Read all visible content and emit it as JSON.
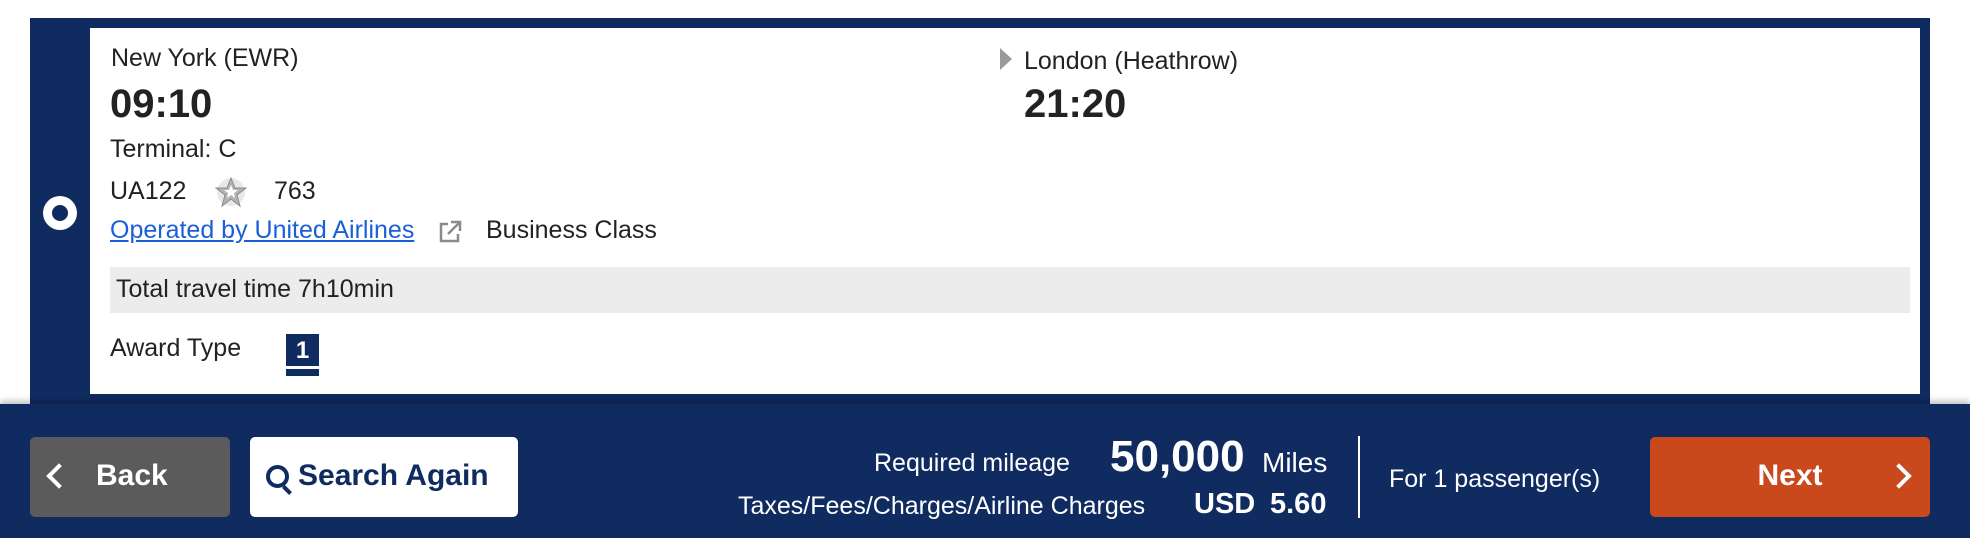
{
  "flight": {
    "origin_city": "New York (EWR)",
    "departure_time": "09:10",
    "destination_city": "London (Heathrow)",
    "arrival_time": "21:20",
    "terminal": "Terminal: C",
    "flight_number": "UA122",
    "aircraft": "763",
    "operated_by": "Operated by United Airlines",
    "cabin_class": "Business Class",
    "total_travel_time": "Total travel time 7h10min",
    "award_type_label": "Award Type",
    "award_type_value": "1"
  },
  "footer": {
    "back_label": "Back",
    "search_again_label": "Search Again",
    "required_mileage_label": "Required mileage",
    "mileage_value": "50,000",
    "mileage_unit": "Miles",
    "taxes_label": "Taxes/Fees/Charges/Airline Charges",
    "currency": "USD",
    "taxes_value": "5.60",
    "passengers": "For 1 passenger(s)",
    "next_label": "Next"
  },
  "icons": {
    "radio": "radio-button-icon",
    "arrow": "arrow-right-icon",
    "alliance": "star-alliance-icon",
    "external": "external-link-icon",
    "back": "chevron-left-icon",
    "search": "search-icon",
    "next": "chevron-right-icon"
  },
  "colors": {
    "navy": "#102b60",
    "next_orange": "#c9481c",
    "back_gray": "#5b5b5b",
    "link_blue": "#1a5fd8",
    "travel_bar_gray": "#ececec"
  }
}
